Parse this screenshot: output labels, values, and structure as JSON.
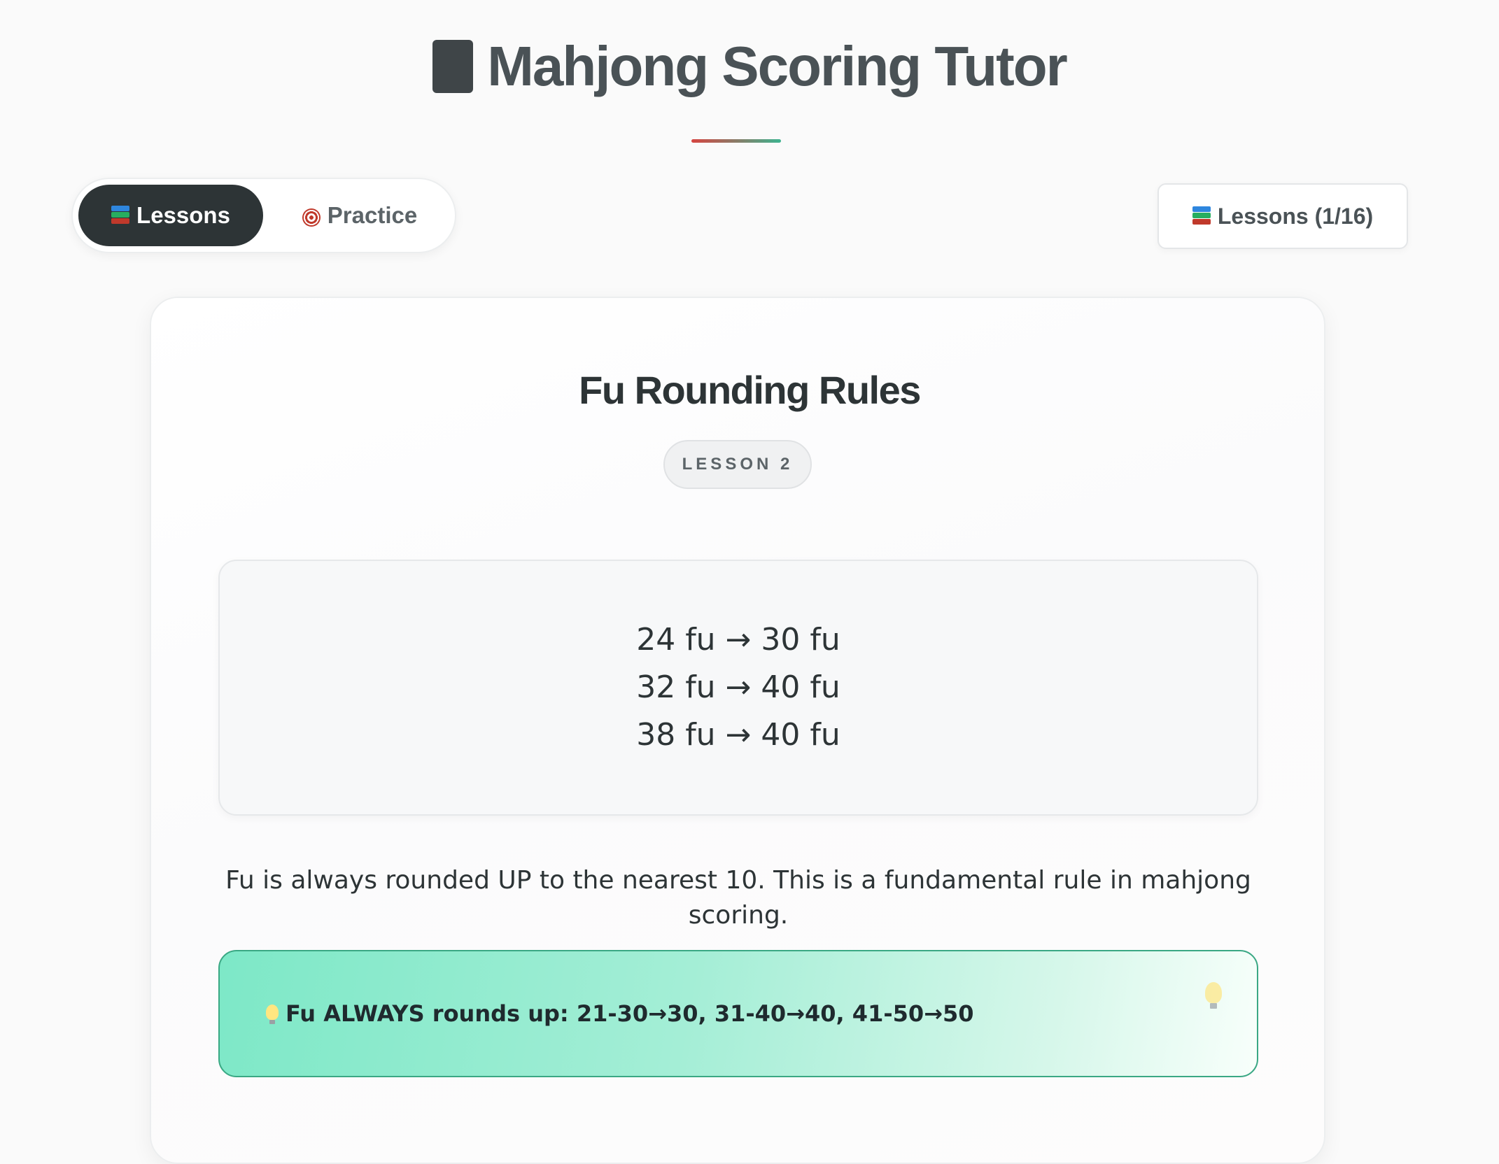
{
  "app": {
    "title": "Mahjong Scoring Tutor",
    "title_icon": "mahjong-tile-icon"
  },
  "tabs": [
    {
      "label": "Lessons",
      "icon": "books-icon",
      "active": true
    },
    {
      "label": "Practice",
      "icon": "target-icon",
      "active": false
    }
  ],
  "lessons_counter": {
    "label": "Lessons (1/16)",
    "icon": "books-icon"
  },
  "lesson": {
    "title": "Fu Rounding Rules",
    "badge": "LESSON 2",
    "examples": [
      "24 fu → 30 fu",
      "32 fu → 40 fu",
      "38 fu → 40 fu"
    ],
    "description": "Fu is always rounded UP to the nearest 10. This is a fundamental rule in mahjong scoring.",
    "tip": "Fu ALWAYS rounds up: 21-30→30, 31-40→40, 41-50→50",
    "tip_icon": "lightbulb-icon"
  },
  "colors": {
    "primary_dark": "#2d3436",
    "accent_red": "#d64541",
    "accent_green": "#3db38f",
    "tip_background": "#7de8c7"
  }
}
